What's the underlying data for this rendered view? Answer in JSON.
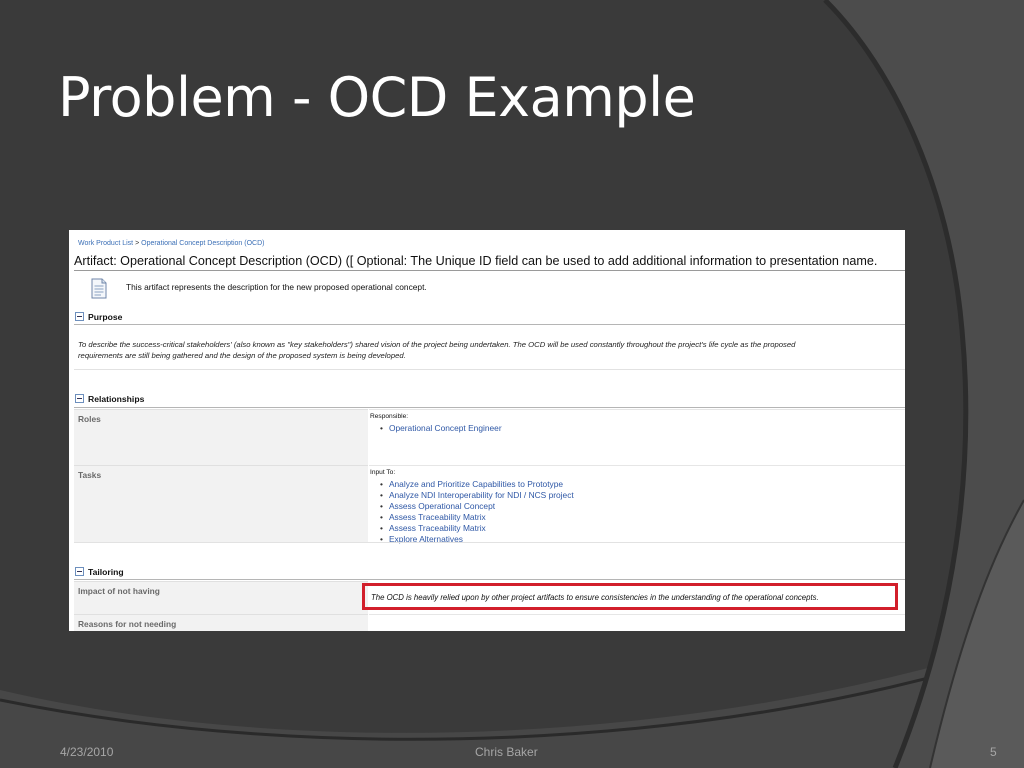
{
  "slide": {
    "title": "Problem - OCD Example",
    "footer": {
      "date": "4/23/2010",
      "author": "Chris Baker",
      "page_number": "5"
    }
  },
  "screenshot": {
    "breadcrumb": {
      "parent_link": "Work Product List",
      "separator": ">",
      "current_link": "Operational Concept Description (OCD)"
    },
    "artifact_title": "Artifact: Operational Concept Description (OCD) ([ Optional: The Unique ID field can be used to add additional information to presentation name.",
    "description": "This artifact represents the description for the new proposed operational concept.",
    "purpose": {
      "heading": "Purpose",
      "text_line1": "To describe the success-critical stakeholders' (also known as \"key stakeholders\") shared vision of the project being undertaken. The OCD will be used constantly throughout the project's life cycle as the proposed",
      "text_line2": "requirements are still being gathered and the design of the proposed system is being developed."
    },
    "relationships": {
      "heading": "Relationships",
      "roles": {
        "label": "Roles",
        "sub_label": "Responsible:",
        "items": [
          "Operational Concept Engineer"
        ]
      },
      "tasks": {
        "label": "Tasks",
        "sub_label": "Input To:",
        "items": [
          "Analyze and Prioritize Capabilities to Prototype",
          "Analyze NDI Interoperability for NDI / NCS project",
          "Assess Operational Concept",
          "Assess Traceability Matrix",
          "Assess Traceability Matrix",
          "Explore Alternatives"
        ]
      }
    },
    "tailoring": {
      "heading": "Tailoring",
      "impact_label": "Impact of not having",
      "impact_text": "The OCD is heavily relied upon by other project artifacts to ensure consistencies in the understanding of the operational concepts.",
      "reasons_label": "Reasons for not needing"
    }
  },
  "colors": {
    "background": "#3a3a3a",
    "highlight_border": "#d21f2b",
    "link": "#2f58a6"
  }
}
